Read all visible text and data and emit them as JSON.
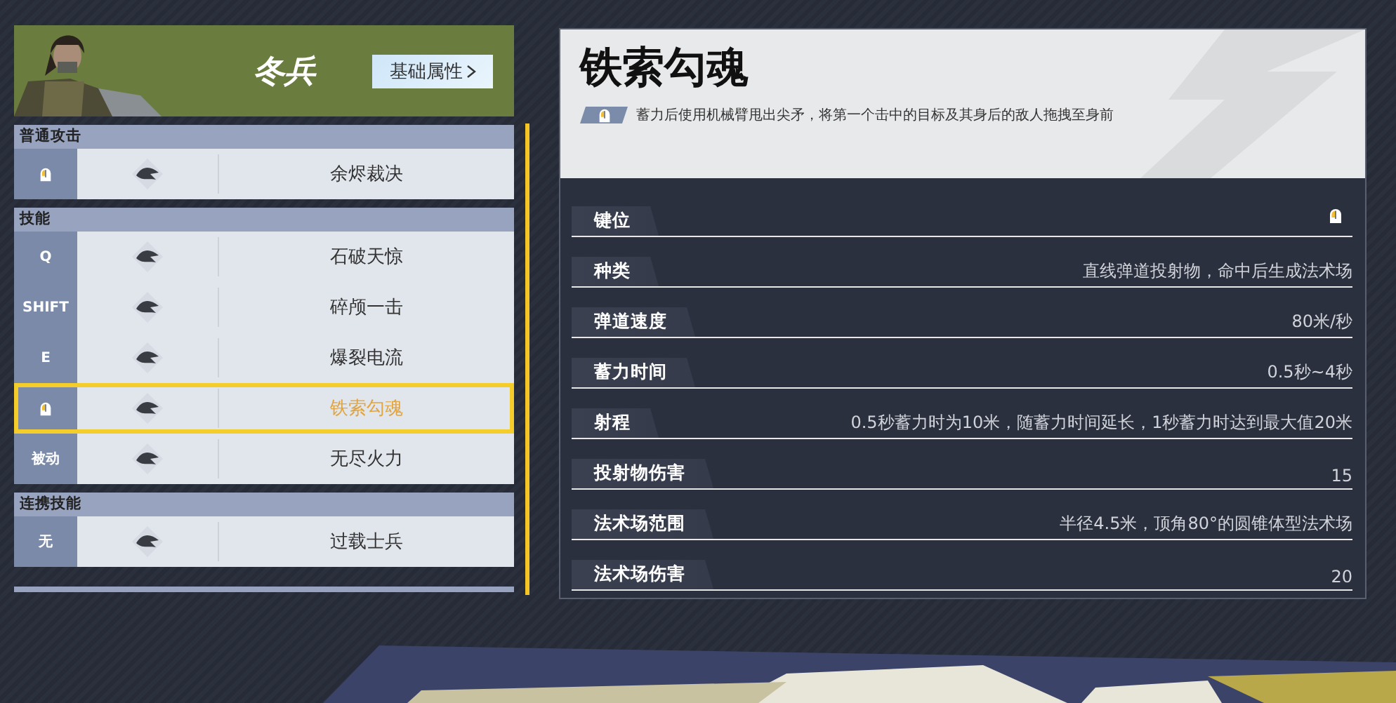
{
  "hero": {
    "name": "冬兵",
    "button": "基础属性"
  },
  "sections": [
    {
      "title": "普通攻击",
      "skills": [
        {
          "kind": "mouse",
          "name": "余烬裁决",
          "selected": false
        }
      ]
    },
    {
      "title": "技能",
      "skills": [
        {
          "kind": "key",
          "key": "Q",
          "name": "石破天惊",
          "selected": false
        },
        {
          "kind": "key",
          "key": "SHIFT",
          "name": "碎颅一击",
          "selected": false
        },
        {
          "kind": "key",
          "key": "E",
          "name": "爆裂电流",
          "selected": false
        },
        {
          "kind": "mouse",
          "name": "铁索勾魂",
          "selected": true
        },
        {
          "kind": "key",
          "key": "被动",
          "name": "无尽火力",
          "selected": false
        }
      ]
    },
    {
      "title": "连携技能",
      "skills": [
        {
          "kind": "key",
          "key": "无",
          "name": "过载士兵",
          "selected": false
        }
      ]
    }
  ],
  "detail": {
    "title": "铁索勾魂",
    "description": "蓄力后使用机械臂甩出尖矛，将第一个击中的目标及其身后的敌人拖拽至身前",
    "stats": [
      {
        "label": "键位",
        "kind": "mouse"
      },
      {
        "label": "种类",
        "kind": "text",
        "value": "直线弹道投射物，命中后生成法术场"
      },
      {
        "label": "弹道速度",
        "kind": "text",
        "value": "80米/秒"
      },
      {
        "label": "蓄力时间",
        "kind": "text",
        "value": "0.5秒~4秒"
      },
      {
        "label": "射程",
        "kind": "text",
        "value": "0.5秒蓄力时为10米，随蓄力时间延长，1秒蓄力时达到最大值20米"
      },
      {
        "label": "投射物伤害",
        "kind": "text",
        "value": "15"
      },
      {
        "label": "法术场范围",
        "kind": "text",
        "value": "半径4.5米，顶角80°的圆锥体型法术场"
      },
      {
        "label": "法术场伤害",
        "kind": "text",
        "value": "20"
      }
    ]
  }
}
